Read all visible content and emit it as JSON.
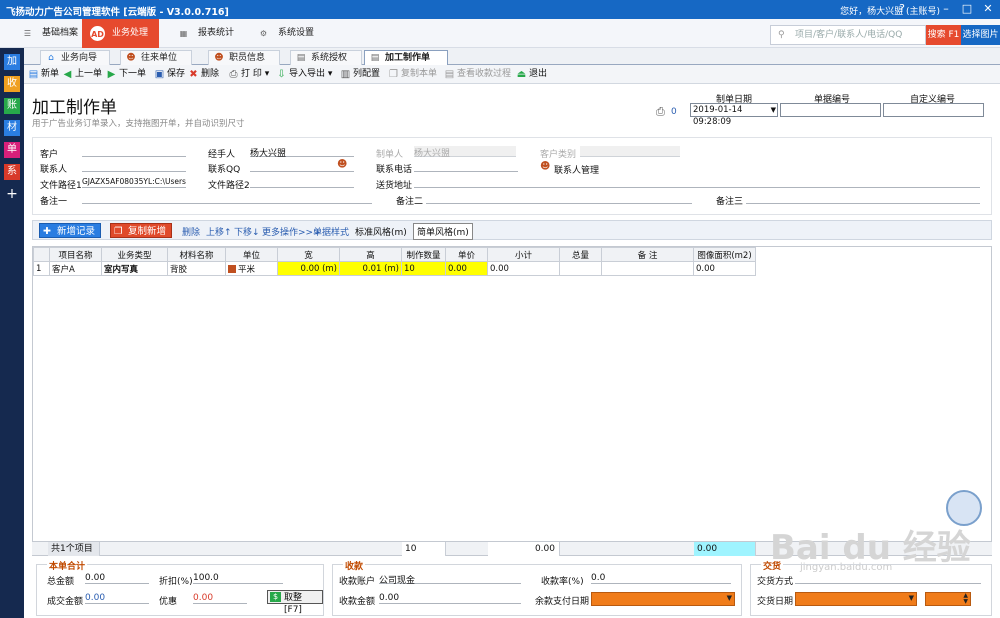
{
  "window": {
    "title": "飞扬动力广告公司管理软件 [云端版 - V3.0.0.716]",
    "greeting": "您好，杨大兴盟 (主账号)"
  },
  "nav": {
    "items": [
      {
        "label": "基础档案",
        "icon": "list-icon"
      },
      {
        "label": "业务处理",
        "icon": "ad-icon",
        "icon_text": "AD"
      },
      {
        "label": "报表统计",
        "icon": "chart-icon"
      },
      {
        "label": "系统设置",
        "icon": "gear-icon"
      }
    ],
    "search_placeholder": "项目/客户/联系人/电话/QQ",
    "search_button": "搜索 F1",
    "select_unit": "选择图片"
  },
  "leftbar": [
    "加",
    "收",
    "账",
    "材",
    "单",
    "系",
    "+"
  ],
  "tabs": [
    {
      "label": "业务向导"
    },
    {
      "label": "往来单位"
    },
    {
      "label": "职员信息"
    },
    {
      "label": "系统授权"
    },
    {
      "label": "加工制作单"
    }
  ],
  "toolbar": {
    "new": "新单",
    "prev": "上一单",
    "next": "下一单",
    "save": "保存",
    "delete": "删除",
    "print": "打 印",
    "import_export": "导入导出",
    "columns": "列配置",
    "copy": "复制本单",
    "view_receipt": "查看收款过程",
    "exit": "退出"
  },
  "page": {
    "title": "加工制作单",
    "subtitle": "用于广告业务订单录入，支持拖图开单，并自动识别尺寸",
    "printer_count": "0",
    "date_label": "制单日期",
    "date_value": "2019-01-14 09:28:09",
    "doc_no_label": "单据编号",
    "custom_no_label": "自定义编号"
  },
  "form": {
    "customer": "客户",
    "contact": "联系人",
    "filepath1": "文件路径1",
    "filepath1_value": "GJAZX5AF08035YL:C:\\Users",
    "remark1": "备注一",
    "handler": "经手人",
    "handler_value": "杨大兴盟",
    "qq": "联系QQ",
    "filepath2": "文件路径2",
    "remark2": "备注二",
    "maker": "制单人",
    "maker_value": "杨大兴盟",
    "phone": "联系电话",
    "address": "送货地址",
    "remark3": "备注三",
    "customer_type": "客户类别",
    "contact_manage": "联系人管理"
  },
  "grid_toolbar": {
    "add": "新增记录",
    "copy_add": "复制新增",
    "delete": "删除",
    "up": "上移",
    "down": "下移",
    "more": "更多操作>>>",
    "style": "单据样式",
    "standard": "标准风格(m)",
    "simple": "简单风格(m)"
  },
  "grid": {
    "headers": [
      "",
      "项目名称",
      "业务类型",
      "材料名称",
      "单位",
      "宽",
      "高",
      "制作数量",
      "单价",
      "小计",
      "总量",
      "备 注",
      "图像面积(m2)"
    ],
    "rows": [
      [
        "1",
        "客户A",
        "室内写真",
        "背胶",
        "平米",
        "0.00 (m)",
        "0.01 (m)",
        "10",
        "0.00",
        "0.00",
        "",
        "",
        "0.00"
      ]
    ],
    "summary": {
      "count": "共1个项目",
      "qty": "10",
      "subtotal": "0.00",
      "area": "0.00"
    }
  },
  "totals": {
    "title": "本单合计",
    "total_label": "总金额",
    "total_value": "0.00",
    "discount_label": "折扣(%)",
    "discount_value": "100.0",
    "deal_label": "成交金额",
    "deal_value": "0.00",
    "offer_label": "优惠",
    "offer_value": "0.00",
    "round_button": "取整[F7]"
  },
  "receipt": {
    "title": "收款",
    "account_label": "收款账户",
    "account_value": "公司现金",
    "amount_label": "收款金额",
    "amount_value": "0.00",
    "rate_label": "收款率(%)",
    "rate_value": "0.0",
    "due_label": "余款支付日期"
  },
  "delivery": {
    "title": "交货",
    "method_label": "交货方式",
    "date_label": "交货日期"
  },
  "watermark": {
    "brand": "Bai du 经验",
    "url": "jingyan.baidu.com"
  }
}
